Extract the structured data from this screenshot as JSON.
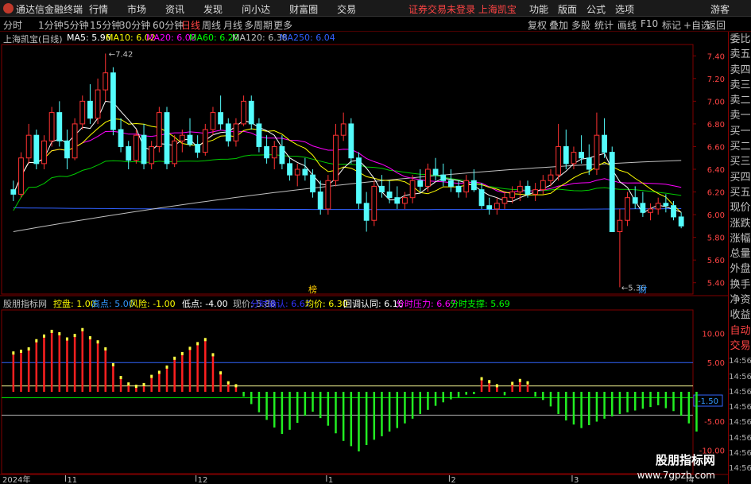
{
  "window": {
    "app_name": "通达信金融终端",
    "menus": [
      "行情",
      "市场",
      "资讯",
      "发现",
      "问小达",
      "财富圈",
      "交易"
    ],
    "notice": "证券交易未登录 上海凯宝",
    "right_menus": [
      "功能",
      "版面",
      "公式",
      "选项"
    ],
    "guest": "游客"
  },
  "toolbar": {
    "periods": [
      "分时",
      "1分钟",
      "5分钟",
      "15分钟",
      "30分钟",
      "60分钟",
      "日线",
      "周线",
      "月线",
      "多周期",
      "更多"
    ],
    "active_period": "日线",
    "tools": [
      "复权",
      "叠加",
      "多股",
      "统计",
      "画线",
      "F10",
      "标记",
      "+自选",
      "返回"
    ]
  },
  "info": {
    "stock_title": "上海凯宝(日线)",
    "ma": [
      {
        "label": "MA5: 5.96",
        "color": "#ffffff"
      },
      {
        "label": "MA10: 6.02",
        "color": "#ffff00"
      },
      {
        "label": "MA20: 6.08",
        "color": "#ff00ff"
      },
      {
        "label": "MA60: 6.20",
        "color": "#00ff00"
      },
      {
        "label": "MA120: 6.38",
        "color": "#c0c0c0"
      },
      {
        "label": "MA250: 6.04",
        "color": "#3060ff"
      }
    ]
  },
  "indicator": {
    "name": "股朋指标网",
    "items": [
      {
        "label": "控盘: 1.00",
        "color": "#ffff00"
      },
      {
        "label": "高点: 5.00",
        "color": "#3399ff"
      },
      {
        "label": "风险: -1.00",
        "color": "#ffff00"
      },
      {
        "label": "低点: -4.00",
        "color": "#ffffff"
      },
      {
        "label": "现价: 5.88",
        "color": "#c0c0c0"
      },
      {
        "label": "分时确认: 6.67",
        "color": "#3333ff"
      },
      {
        "label": "均价: 6.30",
        "color": "#ffff00"
      },
      {
        "label": "回调认同: 6.16",
        "color": "#ffffff"
      },
      {
        "label": "分时压力: 6.67",
        "color": "#ff00ff"
      },
      {
        "label": "分时支撑: 5.69",
        "color": "#00ff00"
      }
    ]
  },
  "side_panel": [
    "委比",
    "卖五",
    "卖四",
    "卖三",
    "卖二",
    "卖一",
    "买一",
    "买二",
    "买三",
    "买四",
    "买五",
    "现价",
    "涨跌",
    "涨幅",
    "总量",
    "外盘",
    "换手",
    "净资",
    "收益"
  ],
  "side_panel_lower": [
    "自动",
    "交易"
  ],
  "side_panel_times": [
    "14:56",
    "14:56",
    "14:56",
    "14:56",
    "14:56",
    "14:56",
    "14:56",
    "14:56"
  ],
  "watermark": "股朋指标网",
  "watermark_url": "www.7gpzb.com",
  "chart_data": {
    "type": "candlestick",
    "price_axis": {
      "ylim": [
        5.3,
        7.5
      ],
      "ticks": [
        "7.40",
        "7.20",
        "7.00",
        "6.80",
        "6.60",
        "6.40",
        "6.20",
        "6.00",
        "5.80",
        "5.60",
        "5.40"
      ]
    },
    "indicator_axis": {
      "ylim": [
        -14,
        14
      ],
      "ticks": [
        "10.00",
        "5.00",
        "-5.00",
        "-10.00"
      ],
      "current_label": "-1.50",
      "current_value": -1.5
    },
    "x_labels": [
      "2024年",
      "11",
      "12",
      "1",
      "2",
      "3",
      "4"
    ],
    "annotations": {
      "high": "7.42",
      "low": "5.36",
      "mark_a": "榜",
      "mark_b": "财"
    },
    "candles": [
      [
        6.22,
        6.3,
        6.12,
        6.18
      ],
      [
        6.18,
        6.55,
        6.15,
        6.5
      ],
      [
        6.5,
        6.8,
        6.45,
        6.7
      ],
      [
        6.7,
        6.75,
        6.4,
        6.45
      ],
      [
        6.45,
        6.7,
        6.4,
        6.65
      ],
      [
        6.65,
        6.95,
        6.6,
        6.9
      ],
      [
        6.9,
        7.0,
        6.6,
        6.65
      ],
      [
        6.65,
        6.75,
        6.4,
        6.5
      ],
      [
        6.5,
        6.85,
        6.48,
        6.8
      ],
      [
        6.8,
        7.05,
        6.75,
        7.0
      ],
      [
        7.0,
        7.15,
        6.8,
        6.85
      ],
      [
        6.85,
        7.2,
        6.8,
        7.1
      ],
      [
        7.1,
        7.42,
        7.0,
        7.25
      ],
      [
        7.25,
        7.3,
        6.7,
        6.75
      ],
      [
        6.75,
        6.85,
        6.55,
        6.6
      ],
      [
        6.6,
        6.65,
        6.4,
        6.48
      ],
      [
        6.48,
        6.75,
        6.45,
        6.7
      ],
      [
        6.7,
        6.8,
        6.4,
        6.45
      ],
      [
        6.45,
        6.65,
        6.4,
        6.6
      ],
      [
        6.6,
        6.95,
        6.55,
        6.9
      ],
      [
        6.9,
        6.95,
        6.4,
        6.45
      ],
      [
        6.45,
        6.7,
        6.42,
        6.65
      ],
      [
        6.65,
        6.75,
        6.55,
        6.7
      ],
      [
        6.7,
        6.85,
        6.6,
        6.62
      ],
      [
        6.62,
        6.7,
        6.5,
        6.55
      ],
      [
        6.55,
        6.8,
        6.52,
        6.75
      ],
      [
        6.75,
        6.95,
        6.7,
        6.9
      ],
      [
        6.9,
        7.05,
        6.75,
        6.8
      ],
      [
        6.8,
        6.85,
        6.6,
        6.65
      ],
      [
        6.65,
        6.85,
        6.6,
        6.8
      ],
      [
        6.8,
        7.05,
        6.78,
        7.0
      ],
      [
        7.0,
        7.05,
        6.75,
        6.8
      ],
      [
        6.8,
        6.85,
        6.55,
        6.6
      ],
      [
        6.6,
        6.7,
        6.45,
        6.5
      ],
      [
        6.5,
        6.65,
        6.4,
        6.6
      ],
      [
        6.6,
        6.7,
        6.4,
        6.45
      ],
      [
        6.45,
        6.5,
        6.3,
        6.35
      ],
      [
        6.35,
        6.45,
        6.25,
        6.4
      ],
      [
        6.4,
        6.5,
        6.3,
        6.35
      ],
      [
        6.35,
        6.4,
        6.15,
        6.2
      ],
      [
        6.2,
        6.3,
        6.0,
        6.05
      ],
      [
        6.05,
        6.35,
        6.0,
        6.3
      ],
      [
        6.3,
        6.8,
        6.25,
        6.7
      ],
      [
        6.7,
        6.9,
        6.65,
        6.8
      ],
      [
        6.8,
        6.85,
        6.45,
        6.5
      ],
      [
        6.5,
        6.55,
        6.05,
        6.1
      ],
      [
        6.1,
        6.2,
        5.85,
        5.95
      ],
      [
        5.95,
        6.3,
        5.9,
        6.25
      ],
      [
        6.25,
        6.35,
        6.15,
        6.2
      ],
      [
        6.2,
        6.3,
        6.1,
        6.15
      ],
      [
        6.15,
        6.25,
        6.05,
        6.1
      ],
      [
        6.1,
        6.2,
        6.05,
        6.15
      ],
      [
        6.15,
        6.35,
        6.1,
        6.3
      ],
      [
        6.3,
        6.4,
        6.2,
        6.25
      ],
      [
        6.25,
        6.45,
        6.2,
        6.4
      ],
      [
        6.4,
        6.5,
        6.3,
        6.35
      ],
      [
        6.35,
        6.45,
        6.25,
        6.3
      ],
      [
        6.3,
        6.4,
        6.2,
        6.25
      ],
      [
        6.25,
        6.3,
        6.15,
        6.2
      ],
      [
        6.2,
        6.35,
        6.15,
        6.3
      ],
      [
        6.3,
        6.4,
        6.2,
        6.22
      ],
      [
        6.22,
        6.28,
        6.05,
        6.08
      ],
      [
        6.08,
        6.15,
        6.0,
        6.05
      ],
      [
        6.05,
        6.15,
        6.0,
        6.1
      ],
      [
        6.1,
        6.2,
        6.05,
        6.15
      ],
      [
        6.15,
        6.25,
        6.1,
        6.2
      ],
      [
        6.2,
        6.3,
        6.12,
        6.25
      ],
      [
        6.25,
        6.3,
        6.15,
        6.18
      ],
      [
        6.18,
        6.28,
        6.12,
        6.22
      ],
      [
        6.22,
        6.35,
        6.18,
        6.3
      ],
      [
        6.3,
        6.4,
        6.25,
        6.35
      ],
      [
        6.35,
        6.8,
        6.3,
        6.6
      ],
      [
        6.6,
        6.75,
        6.4,
        6.45
      ],
      [
        6.45,
        6.6,
        6.4,
        6.55
      ],
      [
        6.55,
        6.7,
        6.45,
        6.5
      ],
      [
        6.5,
        6.62,
        6.35,
        6.4
      ],
      [
        6.4,
        6.9,
        6.35,
        6.7
      ],
      [
        6.7,
        6.85,
        6.5,
        6.55
      ],
      [
        6.55,
        6.6,
        6.2,
        5.85
      ],
      [
        5.85,
        6.05,
        5.36,
        5.95
      ],
      [
        5.95,
        6.2,
        5.9,
        6.15
      ],
      [
        6.15,
        6.25,
        6.05,
        6.1
      ],
      [
        6.1,
        6.2,
        5.98,
        6.02
      ],
      [
        6.02,
        6.1,
        5.95,
        6.05
      ],
      [
        6.05,
        6.15,
        6.0,
        6.1
      ],
      [
        6.1,
        6.18,
        6.02,
        6.08
      ],
      [
        6.08,
        6.12,
        5.95,
        5.98
      ],
      [
        5.98,
        6.02,
        5.88,
        5.9
      ]
    ],
    "indicator_bars": [
      6.5,
      6.8,
      7.2,
      8.6,
      9.4,
      10.2,
      9.8,
      8.9,
      9.5,
      10.5,
      9.1,
      8.4,
      7.2,
      4.5,
      2.3,
      1.2,
      0.8,
      1.1,
      2.5,
      3.2,
      4.1,
      5.6,
      6.4,
      7.3,
      8.1,
      8.8,
      6.2,
      3.1,
      1.4,
      0.9,
      -0.8,
      -2.1,
      -3.5,
      -4.8,
      -6.1,
      -7.2,
      -6.5,
      -5.3,
      -4.1,
      -3.4,
      -4.5,
      -5.8,
      -7.1,
      -8.4,
      -9.3,
      -10.2,
      -9.1,
      -8.2,
      -7.6,
      -6.8,
      -6.2,
      -5.4,
      -4.6,
      -3.8,
      -3.1,
      -2.4,
      -1.8,
      -1.3,
      -0.9,
      -0.5,
      -0.4,
      2.1,
      1.6,
      0.9,
      -0.6,
      1.3,
      1.8,
      1.4,
      -0.8,
      -1.4,
      -2.5,
      -3.8,
      -4.9,
      -5.6,
      -6.2,
      -5.7,
      -5.1,
      -4.6,
      -4.2,
      -3.8,
      -3.5,
      -3.2,
      -2.9,
      -2.6,
      -2.3,
      -2.8,
      -3.3,
      -4.1,
      -5.4,
      -6.8
    ]
  }
}
